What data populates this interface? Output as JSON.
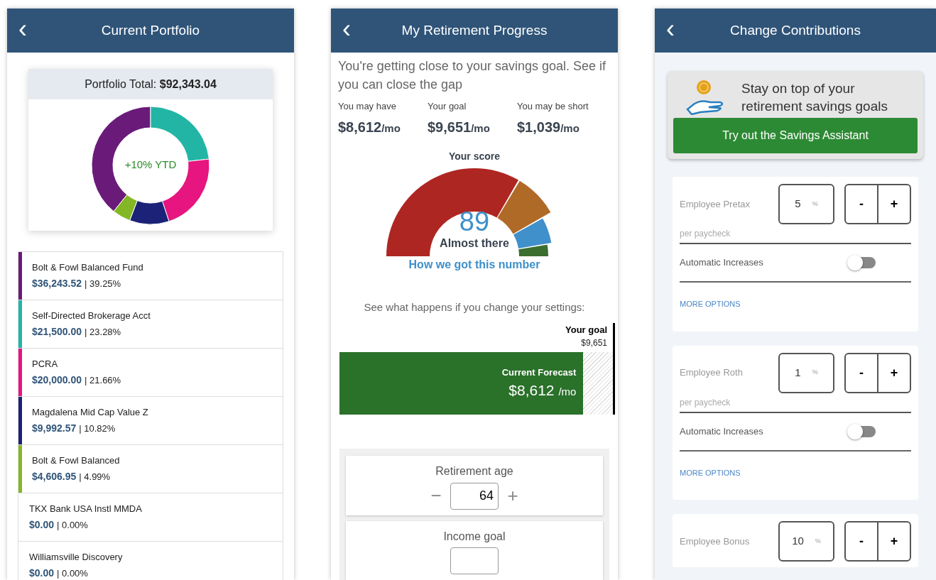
{
  "portfolio_screen": {
    "back": "‹",
    "title": "Current Portfolio",
    "total_label": "Portfolio Total:",
    "total_value": "$92,343.04",
    "ytd": "+10% YTD",
    "chart_data": {
      "type": "donut",
      "values": [
        39.25,
        23.28,
        21.66,
        10.82,
        4.99
      ]
    },
    "holdings": [
      {
        "name": "Bolt & Fowl Balanced Fund",
        "amount": "$36,243.52",
        "share": "| 39.25%",
        "color": "#6a1b7a"
      },
      {
        "name": "Self-Directed Brokerage Acct",
        "amount": "$21,500.00",
        "share": "| 23.28%",
        "color": "#22b5a5"
      },
      {
        "name": "PCRA",
        "amount": "$20,000.00",
        "share": "| 21.66%",
        "color": "#e6157f"
      },
      {
        "name": "Magdalena Mid Cap Value Z",
        "amount": "$9,992.57",
        "share": "| 10.82%",
        "color": "#1b2277"
      },
      {
        "name": "Bolt & Fowl Balanced",
        "amount": "$4,606.95",
        "share": "| 4.99%",
        "color": "#84b725"
      },
      {
        "name": "TKX Bank USA Instl MMDA",
        "amount": "$0.00",
        "share": "| 0.00%"
      },
      {
        "name": "Williamsville Discovery",
        "amount": "$0.00",
        "share": "| 0.00%"
      }
    ]
  },
  "progress_screen": {
    "back": "‹",
    "title": "My Retirement Progress",
    "intro": "You're getting close to your savings goal. See if you can close the gap",
    "stats": [
      {
        "label": "You may have",
        "value": "$8,612",
        "unit": "/mo"
      },
      {
        "label": "Your goal",
        "value": "$9,651",
        "unit": "/mo"
      },
      {
        "label": "You may be short",
        "value": "$1,039",
        "unit": "/mo"
      }
    ],
    "score_label": "Your score",
    "score": "89",
    "score_status": "Almost there",
    "score_link": "How we got this number",
    "settings_hint": "See what happens if you change your settings:",
    "goal_label": "Your goal",
    "goal_value": "$9,651",
    "forecast_label": "Current Forecast",
    "forecast_value": "$8,612",
    "forecast_unit": "/mo",
    "level": 0.892,
    "steppers": [
      {
        "label": "Retirement age",
        "value": "64",
        "minus": "−",
        "plus": "+"
      },
      {
        "label": "Income goal"
      }
    ]
  },
  "contributions_screen": {
    "back": "‹",
    "title": "Change Contributions",
    "promo_text": "Stay on top of your retirement savings goals",
    "promo_button": "Try out the Savings Assistant",
    "contributions": [
      {
        "label": "Employee Pretax",
        "value": "5",
        "unit": "%",
        "minus": "-",
        "plus": "+",
        "note": "per paycheck",
        "toggle_label": "Automatic Increases",
        "on": false,
        "link": "MORE OPTIONS"
      },
      {
        "label": "Employee Roth",
        "value": "1",
        "unit": "%",
        "minus": "-",
        "plus": "+",
        "note": "per paycheck",
        "toggle_label": "Automatic Increases",
        "on": false,
        "link": "MORE OPTIONS"
      },
      {
        "label": "Employee Bonus",
        "value": "10",
        "unit": "%",
        "minus": "-",
        "plus": "+"
      }
    ]
  }
}
